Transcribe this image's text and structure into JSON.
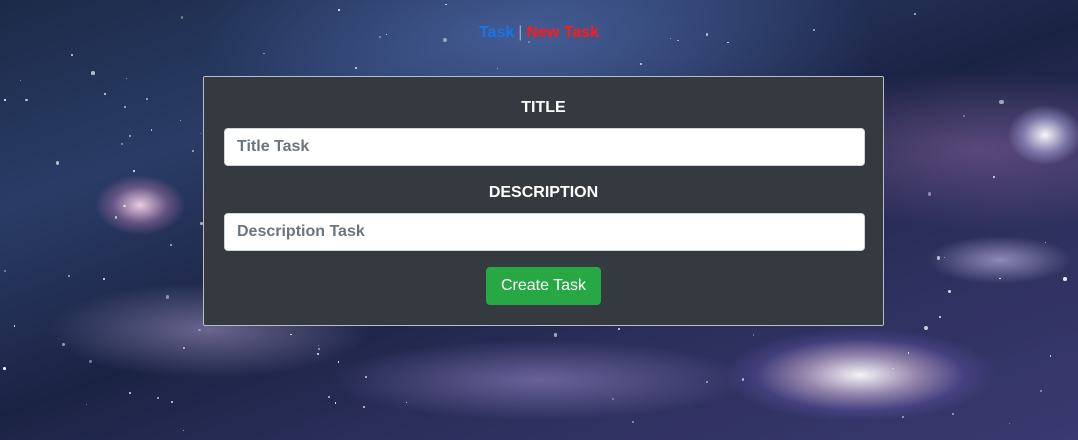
{
  "nav": {
    "task_label": "Task",
    "separator": "|",
    "new_task_label": "New Task"
  },
  "form": {
    "title_label": "TITLE",
    "title_placeholder": "Title Task",
    "title_value": "",
    "description_label": "DESCRIPTION",
    "description_placeholder": "Description Task",
    "description_value": "",
    "submit_label": "Create Task"
  },
  "colors": {
    "nav_task": "#1a73e8",
    "nav_new_task": "#ff1a1a",
    "card_background": "#343a40",
    "button_success": "#28a745"
  }
}
